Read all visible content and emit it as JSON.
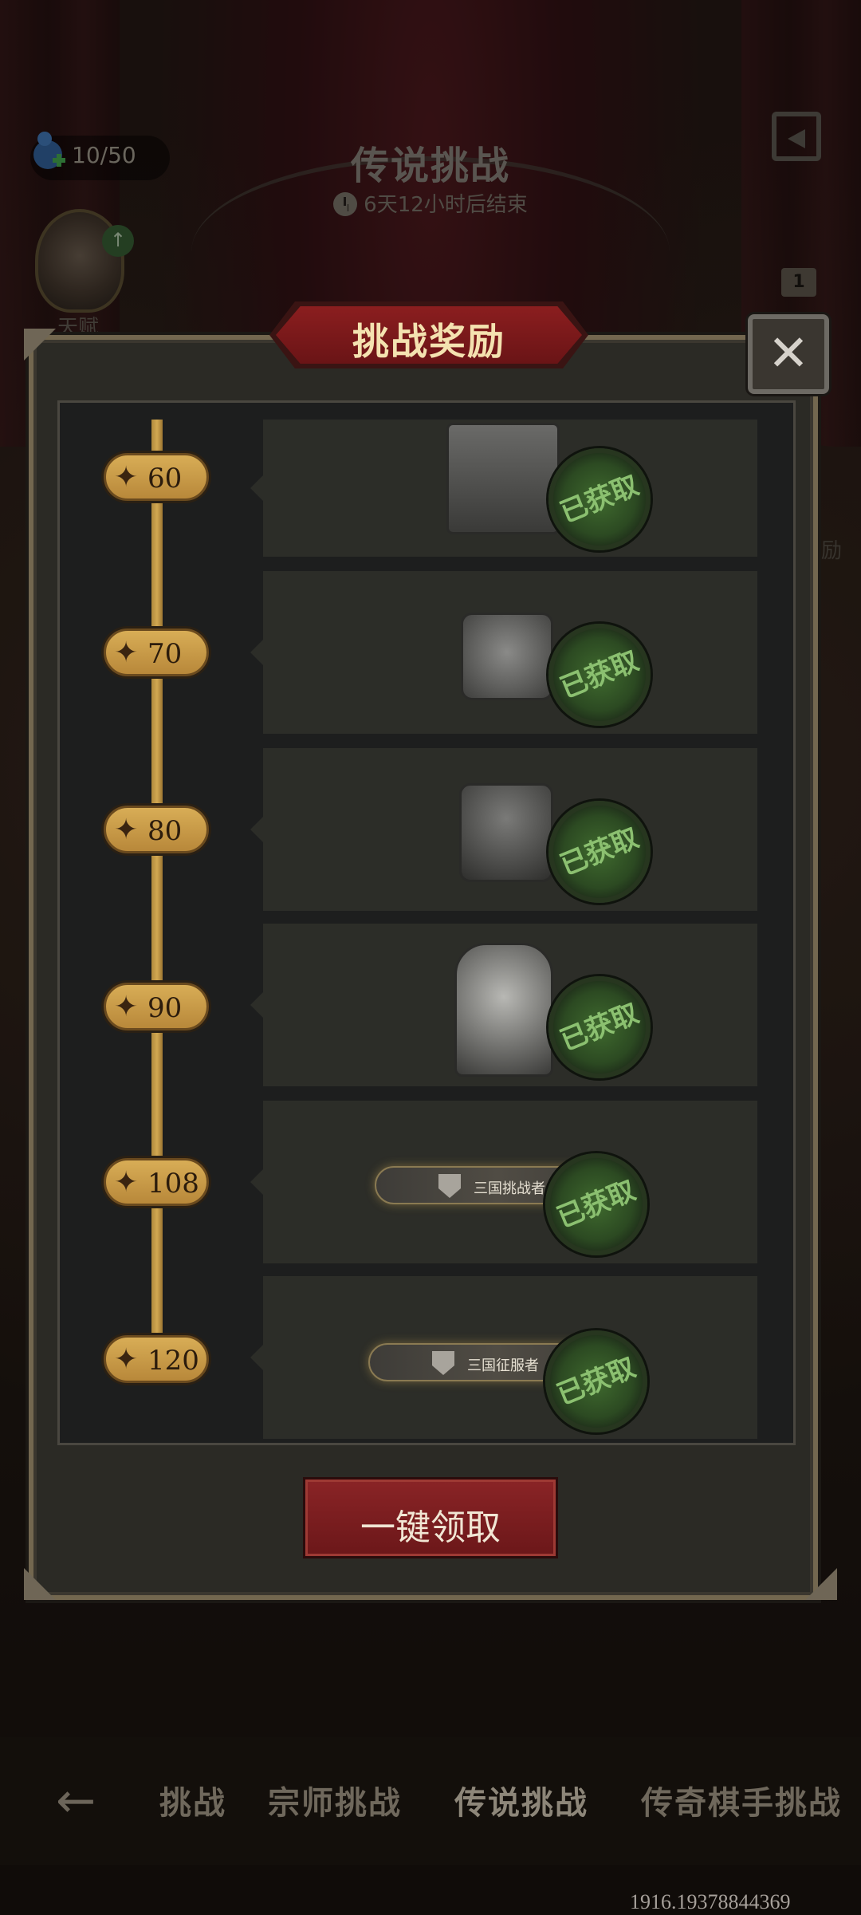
{
  "header": {
    "energy": "10/50",
    "page_title": "传说挑战",
    "timer": "6天12小时后结束",
    "avatar_label": "天赋",
    "side_badge": "1",
    "side_text": "励"
  },
  "dialog": {
    "title": "挑战奖励",
    "close_symbol": "✕",
    "claim_all_label": "一键领取",
    "rewards": [
      {
        "milestone": "60",
        "reward_icon": "curtain-avatar-frame",
        "status": "已获取"
      },
      {
        "milestone": "70",
        "reward_icon": "pumpkin-badge",
        "status": "已获取"
      },
      {
        "milestone": "80",
        "reward_icon": "witch-hat-card",
        "status": "已获取"
      },
      {
        "milestone": "90",
        "reward_icon": "character-portrait",
        "status": "已获取"
      },
      {
        "milestone": "108",
        "reward_icon": "title-badge",
        "reward_title": "三国挑战者",
        "status": "已获取"
      },
      {
        "milestone": "120",
        "reward_icon": "title-badge",
        "reward_title": "三国征服者",
        "status": "已获取"
      }
    ]
  },
  "bottom_nav": {
    "back_symbol": "←",
    "tabs": [
      "挑战",
      "宗师挑战",
      "传说挑战",
      "传奇棋手挑战"
    ],
    "active_tab": "传说挑战"
  },
  "watermark": "1916.19378844369",
  "colors": {
    "accent_gold": "#d8ad56",
    "stamp_green": "#8bc070",
    "button_red": "#8a2426"
  }
}
